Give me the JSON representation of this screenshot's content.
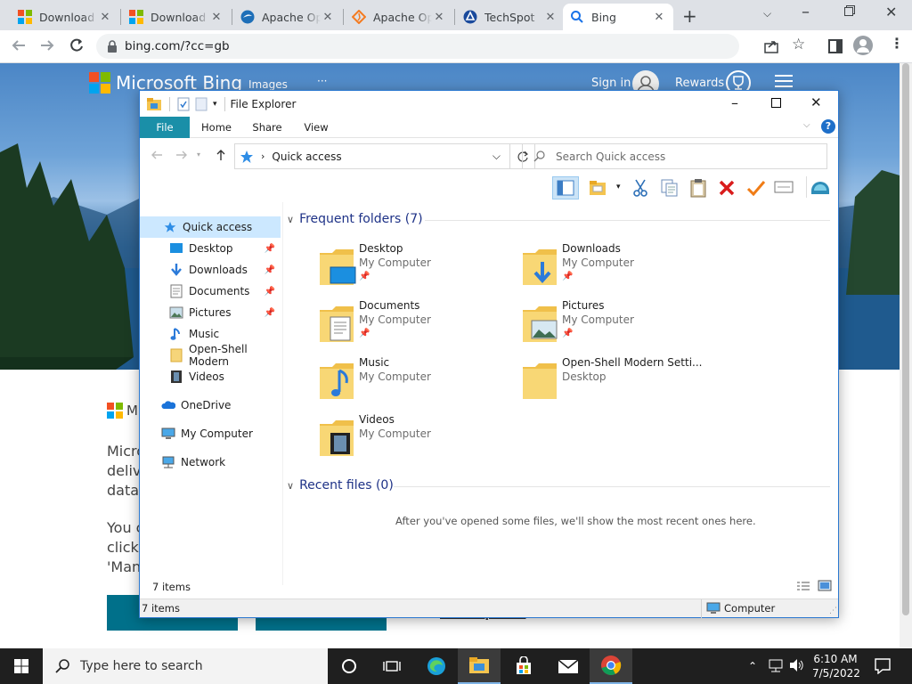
{
  "browser": {
    "tabs": [
      {
        "title": "Download"
      },
      {
        "title": "Download"
      },
      {
        "title": "Apache Op"
      },
      {
        "title": "Apache Op"
      },
      {
        "title": "TechSpot"
      },
      {
        "title": "Bing"
      }
    ],
    "url": "bing.com/?cc=gb"
  },
  "bing": {
    "logo": "Microsoft Bing",
    "nav_images": "Images",
    "nav_more": "···",
    "sign_in": "Sign in",
    "rewards": "Rewards",
    "promo_logo_letter": "M",
    "promo_line1": "Micro",
    "promo_line2": "delive",
    "promo_line3": "data",
    "promo_line4": "You c",
    "promo_line5": "click",
    "promo_line6": "'Man",
    "more_options": "More options"
  },
  "explorer": {
    "title": "File Explorer",
    "tabs": [
      "File",
      "Home",
      "Share",
      "View"
    ],
    "breadcrumb": "Quick access",
    "search_placeholder": "Search Quick access",
    "nav": [
      {
        "label": "Quick access"
      },
      {
        "label": "Desktop",
        "pinned": true
      },
      {
        "label": "Downloads",
        "pinned": true
      },
      {
        "label": "Documents",
        "pinned": true
      },
      {
        "label": "Pictures",
        "pinned": true
      },
      {
        "label": "Music"
      },
      {
        "label": "Open-Shell Modern"
      },
      {
        "label": "Videos"
      },
      {
        "label": "OneDrive"
      },
      {
        "label": "My Computer"
      },
      {
        "label": "Network"
      }
    ],
    "frequent_header": "Frequent folders (7)",
    "folders": [
      {
        "name": "Desktop",
        "location": "My Computer",
        "pinned": true
      },
      {
        "name": "Downloads",
        "location": "My Computer",
        "pinned": true
      },
      {
        "name": "Documents",
        "location": "My Computer",
        "pinned": true
      },
      {
        "name": "Pictures",
        "location": "My Computer",
        "pinned": true
      },
      {
        "name": "Music",
        "location": "My Computer"
      },
      {
        "name": "Open-Shell Modern Setti...",
        "location": "Desktop"
      },
      {
        "name": "Videos",
        "location": "My Computer"
      }
    ],
    "recent_header": "Recent files (0)",
    "recent_empty": "After you've opened some files, we'll show the most recent ones here.",
    "status_items": "7 items",
    "statusbar_items": "7 items",
    "statusbar_computer": "Computer"
  },
  "taskbar": {
    "search_placeholder": "Type here to search",
    "time": "6:10 AM",
    "date": "7/5/2022"
  }
}
